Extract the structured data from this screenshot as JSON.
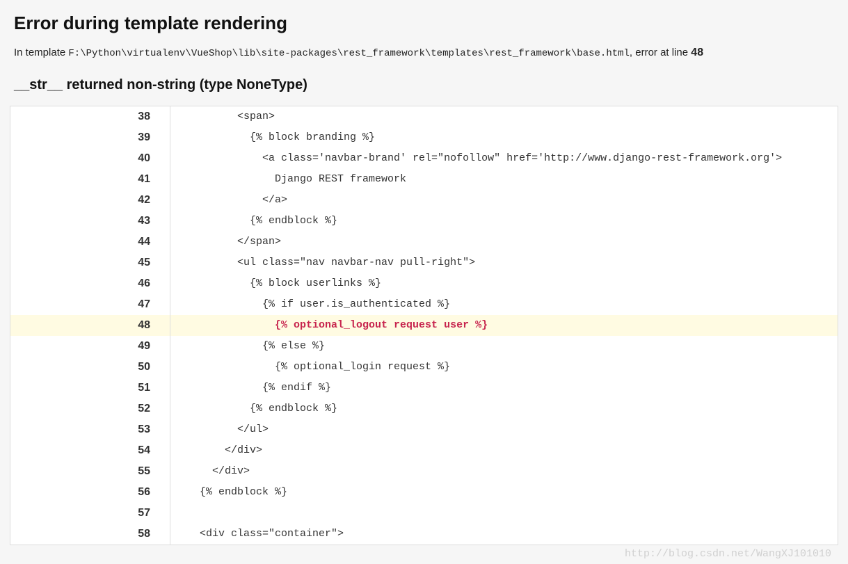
{
  "summary": {
    "title": "Error during template rendering",
    "intro_pre": "In template ",
    "path": "F:\\Python\\virtualenv\\VueShop\\lib\\site-packages\\rest_framework\\templates\\rest_framework\\base.html",
    "intro_mid": ", error at line ",
    "line_no": "48",
    "exception": "__str__ returned non-string (type NoneType)"
  },
  "source": {
    "error_line": 48,
    "lines": [
      {
        "n": 38,
        "code": "          <span>"
      },
      {
        "n": 39,
        "code": "            {% block branding %}"
      },
      {
        "n": 40,
        "code": "              <a class='navbar-brand' rel=\"nofollow\" href='http://www.django-rest-framework.org'>"
      },
      {
        "n": 41,
        "code": "                Django REST framework"
      },
      {
        "n": 42,
        "code": "              </a>"
      },
      {
        "n": 43,
        "code": "            {% endblock %}"
      },
      {
        "n": 44,
        "code": "          </span>"
      },
      {
        "n": 45,
        "code": "          <ul class=\"nav navbar-nav pull-right\">"
      },
      {
        "n": 46,
        "code": "            {% block userlinks %}"
      },
      {
        "n": 47,
        "code": "              {% if user.is_authenticated %}"
      },
      {
        "n": 48,
        "code": "                {% optional_logout request user %}"
      },
      {
        "n": 49,
        "code": "              {% else %}"
      },
      {
        "n": 50,
        "code": "                {% optional_login request %}"
      },
      {
        "n": 51,
        "code": "              {% endif %}"
      },
      {
        "n": 52,
        "code": "            {% endblock %}"
      },
      {
        "n": 53,
        "code": "          </ul>"
      },
      {
        "n": 54,
        "code": "        </div>"
      },
      {
        "n": 55,
        "code": "      </div>"
      },
      {
        "n": 56,
        "code": "    {% endblock %}"
      },
      {
        "n": 57,
        "code": ""
      },
      {
        "n": 58,
        "code": "    <div class=\"container\">"
      }
    ]
  },
  "watermark": "http://blog.csdn.net/WangXJ101010"
}
